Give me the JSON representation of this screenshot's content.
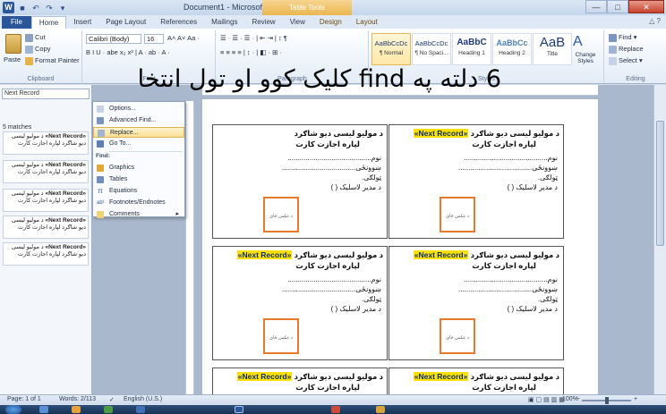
{
  "window": {
    "title": "Document1 - Microsoft Word",
    "contextual_tab_group": "Table Tools",
    "minimize": "—",
    "maximize": "□",
    "close": "✕"
  },
  "qat": {
    "logo": "W",
    "save": "■",
    "undo": "↶",
    "redo": "↷",
    "customize": "▾"
  },
  "tabs": [
    "File",
    "Home",
    "Insert",
    "Page Layout",
    "References",
    "Mailings",
    "Review",
    "View",
    "Design",
    "Layout"
  ],
  "ribbon": {
    "clipboard": {
      "paste": "Paste",
      "cut": "Cut",
      "copy": "Copy",
      "format_painter": "Format Painter",
      "label": "Clipboard"
    },
    "font": {
      "name": "Calibri (Body)",
      "size": "16",
      "label": "Font",
      "row2": "B  I  U  ·  abe  x₂  x²  |  A ·  ab ·  A ·"
    },
    "paragraph": {
      "label": "Paragraph",
      "row1": "☰ ·  ☰ ·  ☰ ·  |  ⇤  ⇥  |  ↕  ¶",
      "row2": "≡  ≡  ≡  ≡  |  ↕ ·  |  ◧ ·  ⊞ ·"
    },
    "styles": {
      "label": "Styles",
      "items": [
        {
          "sample": "AaBbCcDc",
          "name": "¶ Normal"
        },
        {
          "sample": "AaBbCcDc",
          "name": "¶ No Spaci..."
        },
        {
          "sample": "AaBbC",
          "name": "Heading 1"
        },
        {
          "sample": "AaBbCc",
          "name": "Heading 2"
        },
        {
          "sample": "AaB",
          "name": "Title"
        }
      ],
      "change_styles": "Change Styles"
    },
    "editing": {
      "find": "Find",
      "replace": "Replace",
      "select": "Select",
      "label": "Editing"
    }
  },
  "nav_pane": {
    "search_value": "Next Record",
    "matches": "5 matches",
    "results": [
      {
        "highlight": "«Next Record»",
        "text": "د مولیو لیسی دیو شاګرد لپاره اجازت کارت"
      },
      {
        "highlight": "«Next Record»",
        "text": "د مولیو لیسی دیو شاګرد لپاره اجازت کارت"
      },
      {
        "highlight": "«Next Record»",
        "text": "د مولیو لیسی دیو شاګرد لپاره اجازت کارت"
      },
      {
        "highlight": "«Next Record»",
        "text": "د مولیو لیسی دیو شاګرد لپاره اجازت کارت"
      },
      {
        "highlight": "«Next Record»",
        "text": "د مولیو لیسی دیو شاګرد لپاره اجازت کارت"
      }
    ]
  },
  "find_menu": {
    "options": "Options...",
    "advanced_find": "Advanced Find...",
    "replace": "Replace...",
    "go_to": "Go To...",
    "find_heading": "Find:",
    "graphics": "Graphics",
    "tables": "Tables",
    "equations": "Equations",
    "footnotes": "Footnotes/Endnotes",
    "comments": "Comments",
    "submenu_arrow": "▸"
  },
  "card": {
    "merge_field": "«Next Record»",
    "title_a": "د مولیو لیسی دیو شاګرد",
    "title_b": "لپاره اجازت کارت",
    "name_line": "نوم..........................................",
    "school_line": "ښوونځی.....................................",
    "class_line": "ټولګی.",
    "principal_line": "د مدیر لاسلیک (          )",
    "photo": "د عکس ځای"
  },
  "overlay": "6 دلته په find کلیک کوو او تول انتخا",
  "statusbar": {
    "page": "Page: 1 of 1",
    "words": "Words: 2/113",
    "language": "English (U.S.)",
    "zoom": "100%",
    "zoom_minus": "−",
    "zoom_plus": "+"
  }
}
